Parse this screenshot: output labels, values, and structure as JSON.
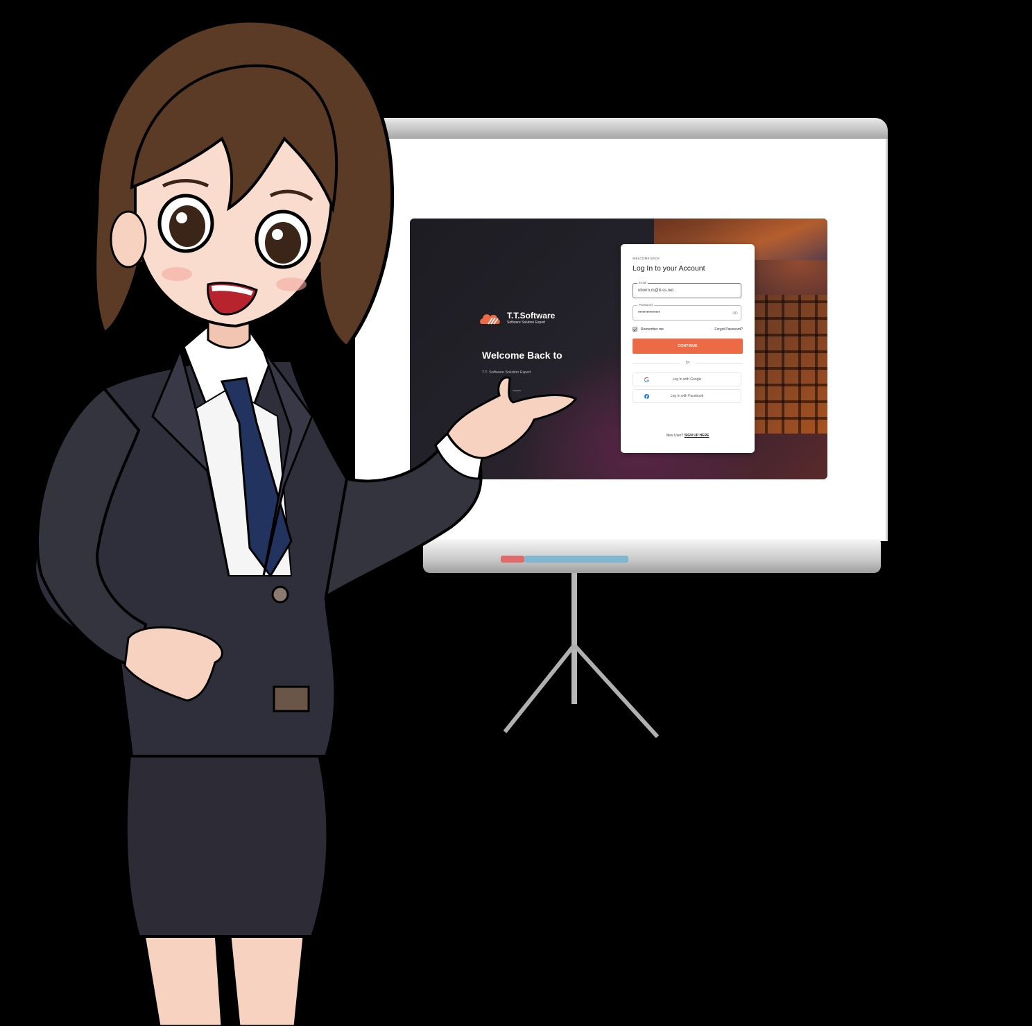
{
  "login_screen": {
    "brand": {
      "name": "T.T.Software",
      "tagline": "Software Solution Expert"
    },
    "hero": {
      "title": "Welcome Back to",
      "subtitle": "T.T. Software Solution Expert"
    },
    "card": {
      "eyebrow": "WELCOME BACK",
      "title": "Log In to your Account",
      "email": {
        "label": "Email",
        "value": "oborm.m@tt-ss.net"
      },
      "password": {
        "label": "Password",
        "value": "•••••••••••••••"
      },
      "remember_me": {
        "label": "Remember me",
        "checked": true
      },
      "forgot_password": "Forgot Password?",
      "continue_label": "CONTINUE",
      "divider": "Or",
      "google_label": "Log In with Google",
      "facebook_label": "Log In with Facebook",
      "signup_prompt": "New User?",
      "signup_link": "SIGN UP HERE"
    },
    "colors": {
      "accent": "#ec6a45",
      "card_background": "#ffffff",
      "screen_background": "#1c1c22"
    }
  },
  "scene": {
    "icons": [
      "brand-logo-icon",
      "eye-icon",
      "google-icon",
      "facebook-icon"
    ],
    "colors": {
      "backdrop": "#000000",
      "suit": "#2a2a35",
      "tie": "#23335f",
      "hair": "#5b3a26"
    }
  }
}
